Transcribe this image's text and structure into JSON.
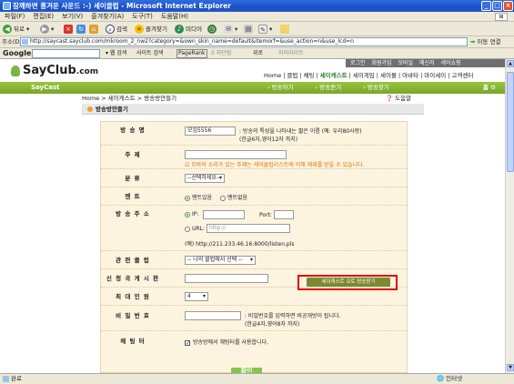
{
  "window": {
    "title": "잠깨하면 흥겨운 사운드 :-) 세이클럽 - Microsoft Internet Explorer",
    "buttons": {
      "min": "_",
      "max": "□",
      "close": "×"
    }
  },
  "menubar": [
    "파일(F)",
    "편집(E)",
    "보기(V)",
    "즐겨찾기(A)",
    "도구(T)",
    "도움말(H)"
  ],
  "toolbar": {
    "back": "뒤로",
    "search": "검색",
    "favorites": "즐겨찾기",
    "media": "미디어"
  },
  "address": {
    "label": "주소(D)",
    "url": "http://saycast.sayclub.com/mkroom_2_nw2?category=&own_skin_name=default&itemorf=&use_action=n&use_lcd=n",
    "go": "이동",
    "links": "연결"
  },
  "googlebar": {
    "logo": "Google -",
    "items": [
      "웹 검색",
      "사이트 검색",
      "PageRank",
      "0 차단됨",
      "위로",
      "하이라이트"
    ]
  },
  "site": {
    "logo": "SayClub",
    "logo_tld": ".com",
    "topstrip": [
      "로그인",
      "회원가입",
      "모바일",
      "메신저",
      "세이쇼핑"
    ],
    "mainnav": [
      "Home",
      "클럽",
      "채팅",
      "세이캐스트",
      "세이게임",
      "세이몰",
      "아바타",
      "마이세이",
      "고객센터"
    ],
    "greenbar_title": "SayCast",
    "subnav": [
      "방송하기",
      "방송듣기",
      "방송찾기"
    ],
    "greenbar_right": "홈",
    "breadcrumb": "Home > 세이캐스트 > 방송방만들기",
    "help": "도움말",
    "page_title": "방송방만들기"
  },
  "form": {
    "rows": [
      {
        "label": "방 송 명",
        "value": "모임5556",
        "note1": ": 방송의 특성을 나타내는 짧은 이름 (예: 우리80사랑)",
        "note2": "(한글6자,영어12자 까지)"
      },
      {
        "label": "주 제",
        "note": "☑ 모바의 소리가 있는 주제는 세이클럽리스트에 의해 제재를 받을 수 있습니다."
      },
      {
        "label": "분 류",
        "select": "--선택하세요--"
      },
      {
        "label": "멘 트",
        "radio1": "멘트있음",
        "radio2": "멘트없음"
      },
      {
        "label": "방 송 주 소",
        "ip_label": "IP:",
        "port_label": "Port:",
        "button": "세이캐스트 오토 방송받기",
        "url_label": "URL:",
        "url_placeholder": "http://",
        "example": "(예) http://211.233.46.16:8000/listen.pls"
      },
      {
        "label": "관 련 클 럽",
        "select": "-- 나의 클럽에서 선택 --"
      },
      {
        "label": "신 청 곡 게 시 판"
      },
      {
        "label": "최 대 인 원",
        "select": "4"
      },
      {
        "label": "비 밀 번 호",
        "note1": ": 비밀번호를 입력하면 비공개방이 됩니다.",
        "note2": "(한글4자,영어8자 까지)"
      },
      {
        "label": "채 팅 터",
        "checkbox": "방송방에서 채팅터를 사용합니다."
      }
    ],
    "submit": "확인"
  },
  "status": {
    "left": "완료",
    "zone": "인터넷"
  }
}
